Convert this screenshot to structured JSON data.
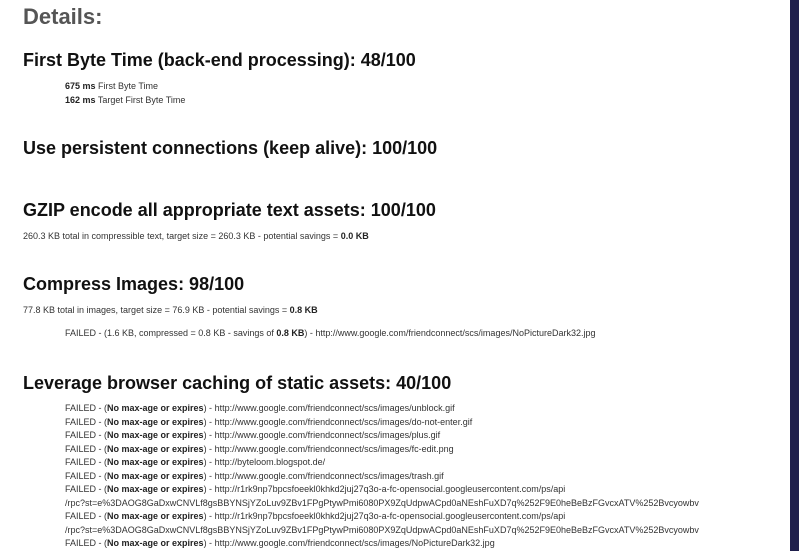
{
  "page_title": "Details:",
  "ttfb": {
    "title": "First Byte Time (back-end processing): 48/100",
    "rows": [
      {
        "value": "675 ms",
        "label": " First Byte Time"
      },
      {
        "value": "162 ms",
        "label": " Target First Byte Time"
      }
    ]
  },
  "keepalive": {
    "title": "Use persistent connections (keep alive): 100/100"
  },
  "gzip": {
    "title": "GZIP encode all appropriate text assets: 100/100",
    "summary_pre": "260.3 KB total in compressible text, target size = 260.3 KB - potential savings = ",
    "summary_bold": "0.0 KB"
  },
  "images": {
    "title": "Compress Images: 98/100",
    "summary_pre": "77.8 KB total in images, target size = 76.9 KB - potential savings = ",
    "summary_bold": "0.8 KB",
    "failed_pre": "FAILED - (1.6 KB, compressed = 0.8 KB - savings of ",
    "failed_bold": "0.8 KB",
    "failed_post": ") - http://www.google.com/friendconnect/scs/images/NoPictureDark32.jpg"
  },
  "caching": {
    "title": "Leverage browser caching of static assets: 40/100",
    "failed_prefix": "FAILED - (",
    "reason": "No max-age or expires",
    "sep": ") - ",
    "items": [
      {
        "url": "http://www.google.com/friendconnect/scs/images/unblock.gif"
      },
      {
        "url": "http://www.google.com/friendconnect/scs/images/do-not-enter.gif"
      },
      {
        "url": "http://www.google.com/friendconnect/scs/images/plus.gif"
      },
      {
        "url": "http://www.google.com/friendconnect/scs/images/fc-edit.png"
      },
      {
        "url": "http://byteloom.blogspot.de/"
      },
      {
        "url": "http://www.google.com/friendconnect/scs/images/trash.gif"
      },
      {
        "url": "http://r1rk9np7bpcsfoeekl0khkd2juj27q3o-a-fc-opensocial.googleusercontent.com/ps/api",
        "cont": "/rpc?st=e%3DAOG8GaDxwCNVLf8gsBBYNSjYZoLuv9ZBv1FPgPtywPmi6080PX9ZqUdpwACpd0aNEshFuXD7q%252F9E0heBeBzFGvcxATV%252Bvcyowbv"
      },
      {
        "url": "http://r1rk9np7bpcsfoeekl0khkd2juj27q3o-a-fc-opensocial.googleusercontent.com/ps/api",
        "cont": "/rpc?st=e%3DAOG8GaDxwCNVLf8gsBBYNSjYZoLuv9ZBv1FPgPtywPmi6080PX9ZqUdpwACpd0aNEshFuXD7q%252F9E0heBeBzFGvcxATV%252Bvcyowbv"
      },
      {
        "url": "http://www.google.com/friendconnect/scs/images/NoPictureDark32.jpg"
      }
    ]
  }
}
